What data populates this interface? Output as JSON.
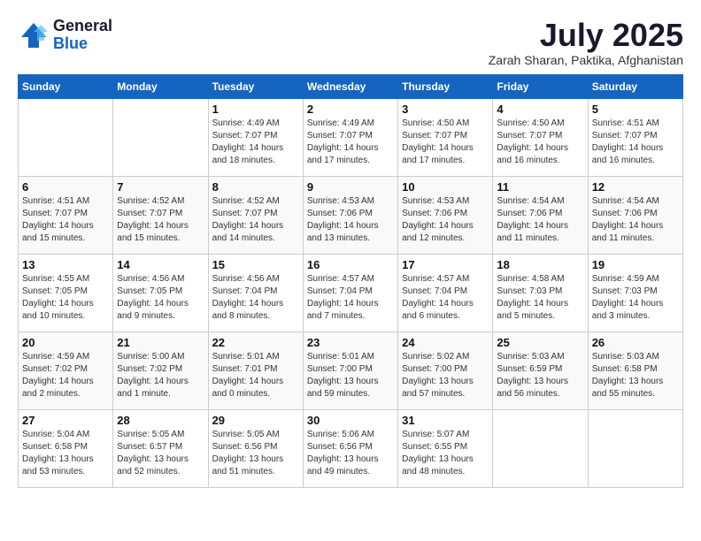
{
  "header": {
    "logo_general": "General",
    "logo_blue": "Blue",
    "title": "July 2025",
    "location": "Zarah Sharan, Paktika, Afghanistan"
  },
  "columns": [
    "Sunday",
    "Monday",
    "Tuesday",
    "Wednesday",
    "Thursday",
    "Friday",
    "Saturday"
  ],
  "weeks": [
    [
      {
        "num": "",
        "detail": ""
      },
      {
        "num": "",
        "detail": ""
      },
      {
        "num": "1",
        "detail": "Sunrise: 4:49 AM\nSunset: 7:07 PM\nDaylight: 14 hours and 18 minutes."
      },
      {
        "num": "2",
        "detail": "Sunrise: 4:49 AM\nSunset: 7:07 PM\nDaylight: 14 hours and 17 minutes."
      },
      {
        "num": "3",
        "detail": "Sunrise: 4:50 AM\nSunset: 7:07 PM\nDaylight: 14 hours and 17 minutes."
      },
      {
        "num": "4",
        "detail": "Sunrise: 4:50 AM\nSunset: 7:07 PM\nDaylight: 14 hours and 16 minutes."
      },
      {
        "num": "5",
        "detail": "Sunrise: 4:51 AM\nSunset: 7:07 PM\nDaylight: 14 hours and 16 minutes."
      }
    ],
    [
      {
        "num": "6",
        "detail": "Sunrise: 4:51 AM\nSunset: 7:07 PM\nDaylight: 14 hours and 15 minutes."
      },
      {
        "num": "7",
        "detail": "Sunrise: 4:52 AM\nSunset: 7:07 PM\nDaylight: 14 hours and 15 minutes."
      },
      {
        "num": "8",
        "detail": "Sunrise: 4:52 AM\nSunset: 7:07 PM\nDaylight: 14 hours and 14 minutes."
      },
      {
        "num": "9",
        "detail": "Sunrise: 4:53 AM\nSunset: 7:06 PM\nDaylight: 14 hours and 13 minutes."
      },
      {
        "num": "10",
        "detail": "Sunrise: 4:53 AM\nSunset: 7:06 PM\nDaylight: 14 hours and 12 minutes."
      },
      {
        "num": "11",
        "detail": "Sunrise: 4:54 AM\nSunset: 7:06 PM\nDaylight: 14 hours and 11 minutes."
      },
      {
        "num": "12",
        "detail": "Sunrise: 4:54 AM\nSunset: 7:06 PM\nDaylight: 14 hours and 11 minutes."
      }
    ],
    [
      {
        "num": "13",
        "detail": "Sunrise: 4:55 AM\nSunset: 7:05 PM\nDaylight: 14 hours and 10 minutes."
      },
      {
        "num": "14",
        "detail": "Sunrise: 4:56 AM\nSunset: 7:05 PM\nDaylight: 14 hours and 9 minutes."
      },
      {
        "num": "15",
        "detail": "Sunrise: 4:56 AM\nSunset: 7:04 PM\nDaylight: 14 hours and 8 minutes."
      },
      {
        "num": "16",
        "detail": "Sunrise: 4:57 AM\nSunset: 7:04 PM\nDaylight: 14 hours and 7 minutes."
      },
      {
        "num": "17",
        "detail": "Sunrise: 4:57 AM\nSunset: 7:04 PM\nDaylight: 14 hours and 6 minutes."
      },
      {
        "num": "18",
        "detail": "Sunrise: 4:58 AM\nSunset: 7:03 PM\nDaylight: 14 hours and 5 minutes."
      },
      {
        "num": "19",
        "detail": "Sunrise: 4:59 AM\nSunset: 7:03 PM\nDaylight: 14 hours and 3 minutes."
      }
    ],
    [
      {
        "num": "20",
        "detail": "Sunrise: 4:59 AM\nSunset: 7:02 PM\nDaylight: 14 hours and 2 minutes."
      },
      {
        "num": "21",
        "detail": "Sunrise: 5:00 AM\nSunset: 7:02 PM\nDaylight: 14 hours and 1 minute."
      },
      {
        "num": "22",
        "detail": "Sunrise: 5:01 AM\nSunset: 7:01 PM\nDaylight: 14 hours and 0 minutes."
      },
      {
        "num": "23",
        "detail": "Sunrise: 5:01 AM\nSunset: 7:00 PM\nDaylight: 13 hours and 59 minutes."
      },
      {
        "num": "24",
        "detail": "Sunrise: 5:02 AM\nSunset: 7:00 PM\nDaylight: 13 hours and 57 minutes."
      },
      {
        "num": "25",
        "detail": "Sunrise: 5:03 AM\nSunset: 6:59 PM\nDaylight: 13 hours and 56 minutes."
      },
      {
        "num": "26",
        "detail": "Sunrise: 5:03 AM\nSunset: 6:58 PM\nDaylight: 13 hours and 55 minutes."
      }
    ],
    [
      {
        "num": "27",
        "detail": "Sunrise: 5:04 AM\nSunset: 6:58 PM\nDaylight: 13 hours and 53 minutes."
      },
      {
        "num": "28",
        "detail": "Sunrise: 5:05 AM\nSunset: 6:57 PM\nDaylight: 13 hours and 52 minutes."
      },
      {
        "num": "29",
        "detail": "Sunrise: 5:05 AM\nSunset: 6:56 PM\nDaylight: 13 hours and 51 minutes."
      },
      {
        "num": "30",
        "detail": "Sunrise: 5:06 AM\nSunset: 6:56 PM\nDaylight: 13 hours and 49 minutes."
      },
      {
        "num": "31",
        "detail": "Sunrise: 5:07 AM\nSunset: 6:55 PM\nDaylight: 13 hours and 48 minutes."
      },
      {
        "num": "",
        "detail": ""
      },
      {
        "num": "",
        "detail": ""
      }
    ]
  ]
}
